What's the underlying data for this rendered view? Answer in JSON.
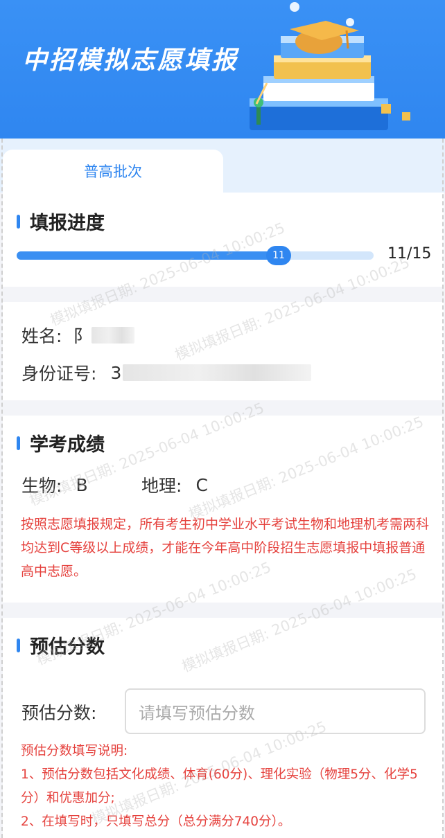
{
  "banner": {
    "title": "中招模拟志愿填报"
  },
  "tabs": [
    {
      "label": "普高批次",
      "active": true
    }
  ],
  "progress": {
    "title": "填报进度",
    "current": 11,
    "total": 15,
    "knob_label": "11",
    "count_text": "11/15"
  },
  "identity": {
    "name_label": "姓名:",
    "name_value_visible": "阝",
    "id_label": "身份证号:",
    "id_value_visible": "3"
  },
  "scores": {
    "title": "学考成绩",
    "items": [
      {
        "label": "生物:",
        "value": "B"
      },
      {
        "label": "地理:",
        "value": "C"
      }
    ],
    "notice": "按照志愿填报规定，所有考生初中学业水平考试生物和地理机考需两科均达到C等级以上成绩，才能在今年高中阶段招生志愿填报中填报普通高中志愿。"
  },
  "estimate": {
    "title": "预估分数",
    "field_label": "预估分数:",
    "placeholder": "请填写预估分数",
    "notes": [
      "预估分数填写说明:",
      "1、预估分数包括文化成绩、体育(60分)、理化实验（物理5分、化学5分）和优惠加分;",
      "2、在填写时，只填写总分（总分满分740分）。"
    ]
  },
  "watermark": "模拟填报日期: 2025-06-04 10:00:25",
  "colors": {
    "accent": "#2f86f0",
    "warning": "#e5413d"
  }
}
